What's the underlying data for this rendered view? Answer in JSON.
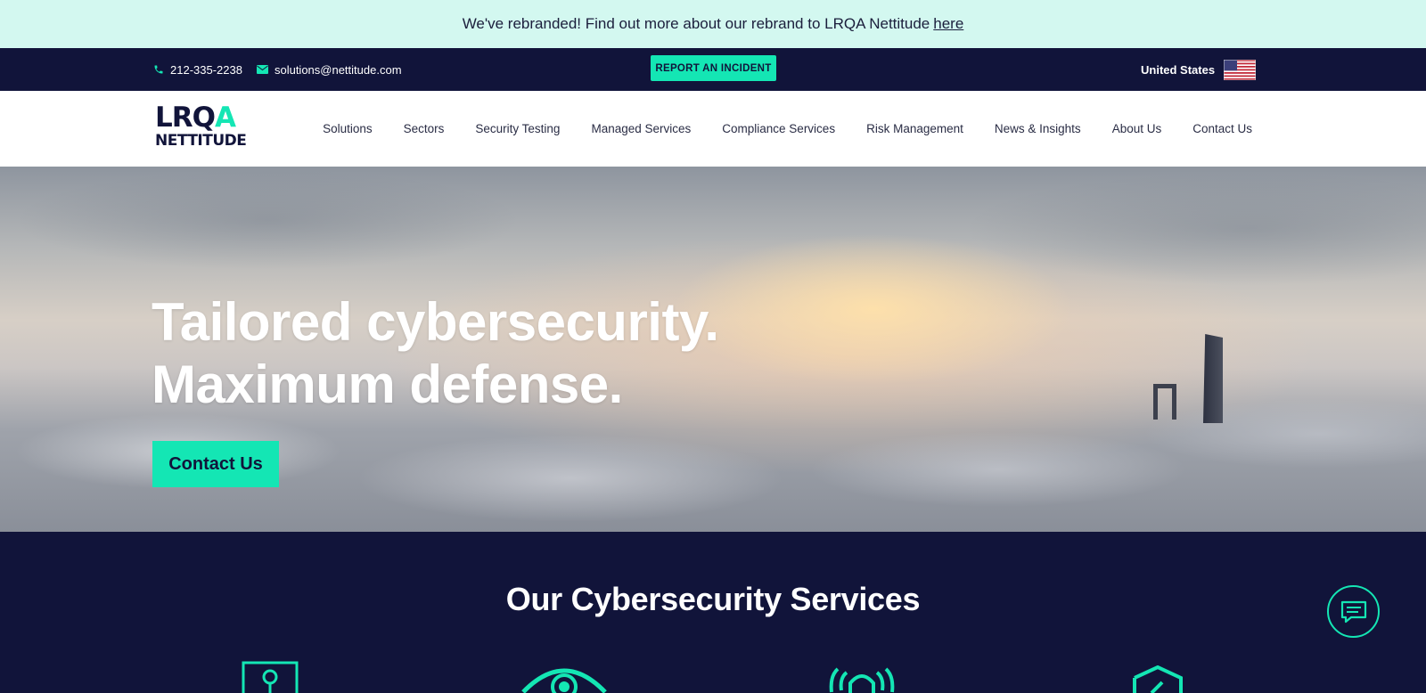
{
  "banner": {
    "text": "We've rebranded! Find out more about our rebrand to LRQA Nettitude",
    "link": "here"
  },
  "topbar": {
    "phone": "212-335-2238",
    "email": "solutions@nettitude.com",
    "incident_button": "REPORT AN INCIDENT",
    "country": "United States",
    "icons": {
      "phone": "phone-icon",
      "email": "envelope-icon",
      "flag": "us-flag-icon"
    }
  },
  "logo": {
    "line1_a": "LRQ",
    "line1_b": "A",
    "line2": "NETTITUDE"
  },
  "nav": {
    "items": [
      "Solutions",
      "Sectors",
      "Security Testing",
      "Managed Services",
      "Compliance Services",
      "Risk Management",
      "News & Insights",
      "About Us",
      "Contact Us"
    ]
  },
  "hero": {
    "headline_line1": "Tailored cybersecurity.",
    "headline_line2": "Maximum defense.",
    "cta": "Contact Us"
  },
  "services": {
    "title": "Our Cybersecurity Services",
    "icons": [
      "keyhole-icon",
      "eye-icon",
      "alarm-icon",
      "shield-icon"
    ]
  },
  "chat": {
    "icon": "chat-icon"
  },
  "colors": {
    "accent": "#14e6b4",
    "navy": "#11143a",
    "banner_bg": "#d3f8f0"
  }
}
